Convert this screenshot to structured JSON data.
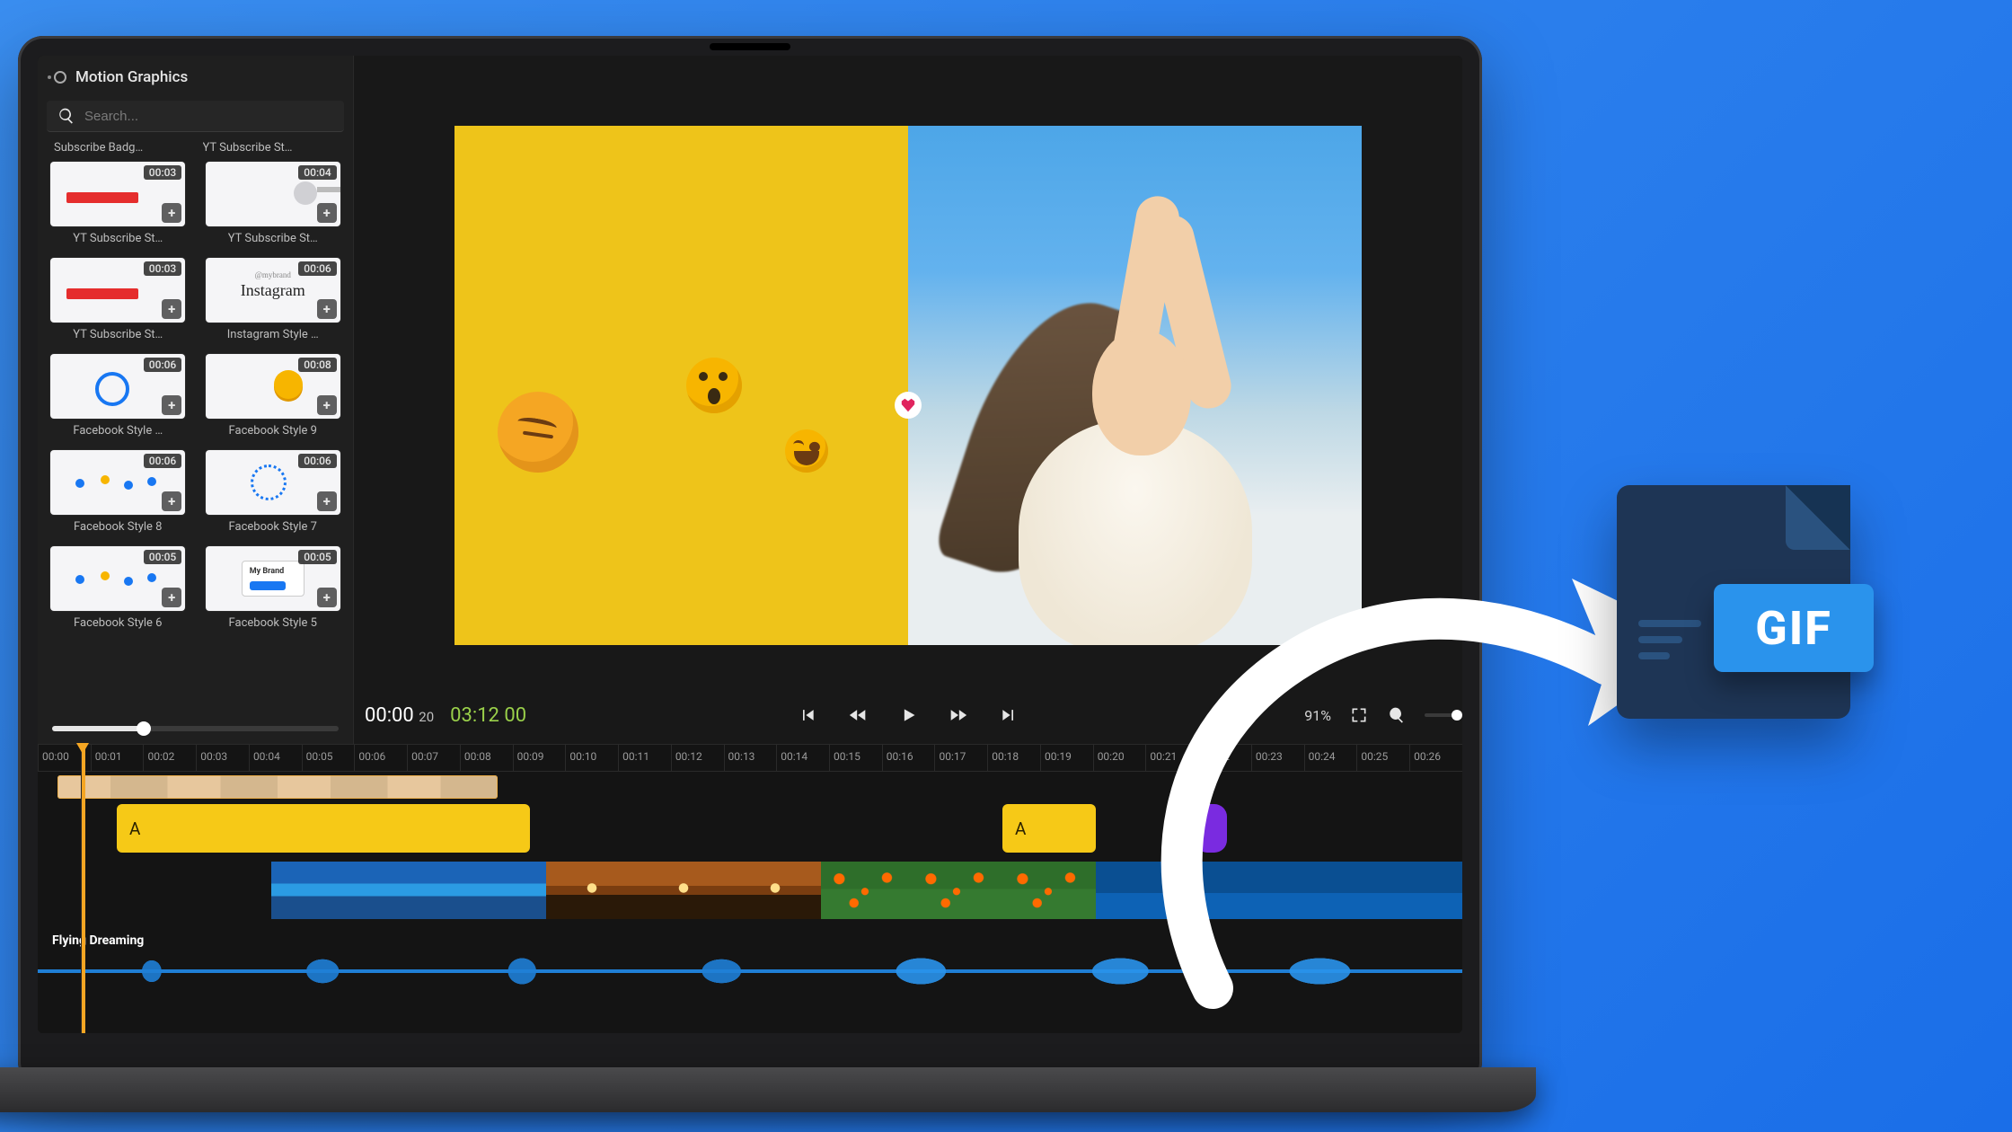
{
  "sidebar": {
    "title": "Motion Graphics",
    "search_placeholder": "Search...",
    "top_row_labels": [
      "Subscribe Badg…",
      "YT Subscribe St…"
    ],
    "assets": [
      {
        "label": "YT Subscribe St…",
        "duration": "00:03",
        "thumb": "yt-red"
      },
      {
        "label": "YT Subscribe St…",
        "duration": "00:04",
        "thumb": "channel"
      },
      {
        "label": "YT Subscribe St…",
        "duration": "00:03",
        "thumb": "yt-red"
      },
      {
        "label": "Instagram Style …",
        "duration": "00:06",
        "thumb": "instagram"
      },
      {
        "label": "Facebook Style …",
        "duration": "00:06",
        "thumb": "fb-ring"
      },
      {
        "label": "Facebook Style 9",
        "duration": "00:08",
        "thumb": "fb-emoji"
      },
      {
        "label": "Facebook Style 8",
        "duration": "00:06",
        "thumb": "fb-dots"
      },
      {
        "label": "Facebook Style 7",
        "duration": "00:06",
        "thumb": "fb-loader"
      },
      {
        "label": "Facebook Style 6",
        "duration": "00:05",
        "thumb": "fb-dots"
      },
      {
        "label": "Facebook Style 5",
        "duration": "00:05",
        "thumb": "mybrand"
      }
    ]
  },
  "preview": {
    "current_time": "00:00",
    "current_frame": "20",
    "duration_time": "03:12",
    "duration_frame": "00",
    "zoom_percent": "91%"
  },
  "timeline": {
    "ticks": [
      "00:00",
      "00:01",
      "00:02",
      "00:03",
      "00:04",
      "00:05",
      "00:06",
      "00:07",
      "00:08",
      "00:09",
      "00:10",
      "00:11",
      "00:12",
      "00:13",
      "00:14",
      "00:15",
      "00:16",
      "00:17",
      "00:18",
      "00:19",
      "00:20",
      "00:21",
      "00:22",
      "00:23",
      "00:24",
      "00:25",
      "00:26"
    ],
    "overlay_a1": "A",
    "overlay_a2": "A",
    "audio_label": "Flying Dreaming"
  },
  "export": {
    "badge_text": "GIF"
  }
}
